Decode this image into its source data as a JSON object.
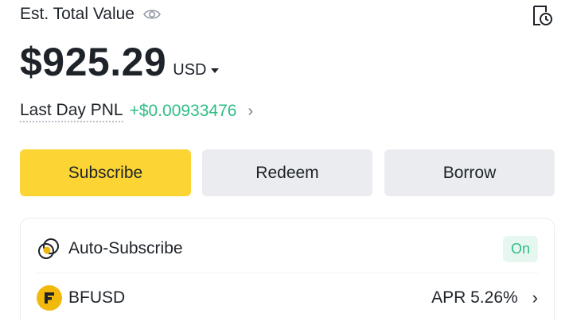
{
  "header": {
    "est_label": "Est. Total Value",
    "eye_icon": "eye-icon",
    "history_icon": "history-icon"
  },
  "balance": {
    "amount": "$925.29",
    "currency": "USD"
  },
  "pnl": {
    "label": "Last Day PNL",
    "value": "+$0.00933476",
    "chevron": "›"
  },
  "actions": {
    "subscribe": "Subscribe",
    "redeem": "Redeem",
    "borrow": "Borrow"
  },
  "card": {
    "auto_label": "Auto-Subscribe",
    "auto_status": "On",
    "coin_label": "BFUSD",
    "apr": "APR 5.26%",
    "chevron": "›"
  },
  "colors": {
    "accent": "#fcd535",
    "positive": "#2ebd85",
    "button_gray": "#eaecef"
  }
}
